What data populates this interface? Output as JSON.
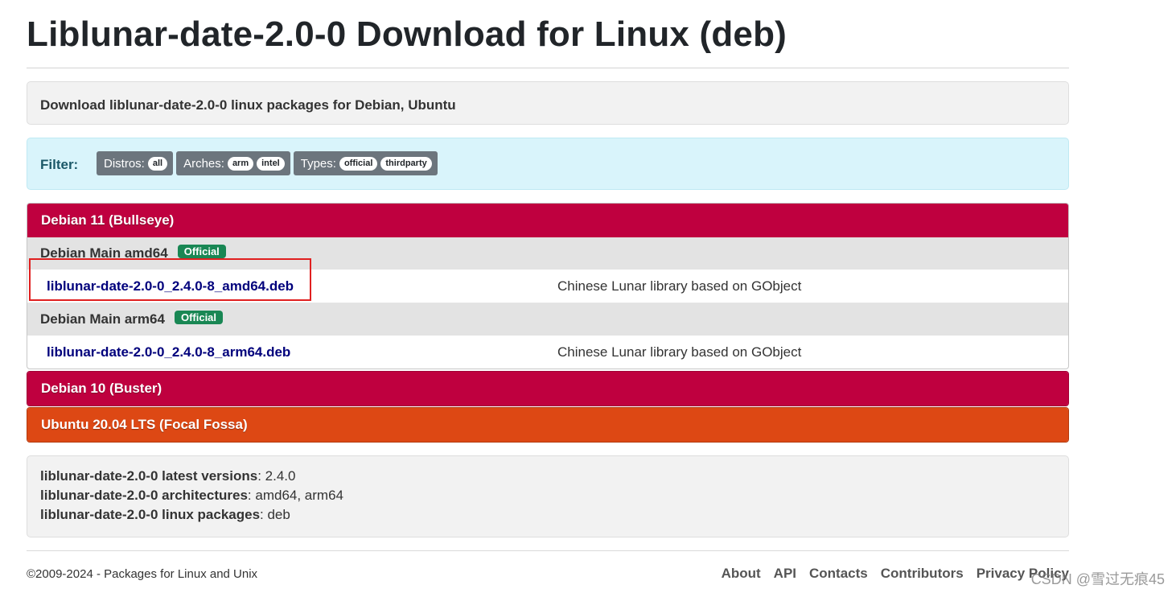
{
  "page": {
    "title": "Liblunar-date-2.0-0 Download for Linux (deb)",
    "description": "Download liblunar-date-2.0-0 linux packages for Debian, Ubuntu"
  },
  "filter": {
    "label": "Filter:",
    "groups": [
      {
        "label": "Distros:",
        "options": [
          "all"
        ]
      },
      {
        "label": "Arches:",
        "options": [
          "arm",
          "intel"
        ]
      },
      {
        "label": "Types:",
        "options": [
          "official",
          "thirdparty"
        ]
      }
    ]
  },
  "distros": [
    {
      "name": "Debian 11 (Bullseye)",
      "color": "#bf003f",
      "repos": [
        {
          "name": "Debian Main amd64",
          "badge": "Official",
          "package": "liblunar-date-2.0-0_2.4.0-8_amd64.deb",
          "summary": "Chinese Lunar library based on GObject"
        },
        {
          "name": "Debian Main arm64",
          "badge": "Official",
          "package": "liblunar-date-2.0-0_2.4.0-8_arm64.deb",
          "summary": "Chinese Lunar library based on GObject"
        }
      ]
    },
    {
      "name": "Debian 10 (Buster)",
      "color": "#bf003f"
    },
    {
      "name": "Ubuntu 20.04 LTS (Focal Fossa)",
      "color": "#dd4814"
    }
  ],
  "info": {
    "latest_label": "liblunar-date-2.0-0 latest versions",
    "latest_value": ": 2.4.0",
    "arch_label": "liblunar-date-2.0-0 architectures",
    "arch_value": ": amd64, arm64",
    "pkgs_label": "liblunar-date-2.0-0 linux packages",
    "pkgs_value": ": deb"
  },
  "footer": {
    "copyright": "©2009-2024 - Packages for Linux and Unix",
    "links": [
      "About",
      "API",
      "Contacts",
      "Contributors",
      "Privacy Policy"
    ]
  },
  "watermark": "CSDN @雪过无痕45"
}
